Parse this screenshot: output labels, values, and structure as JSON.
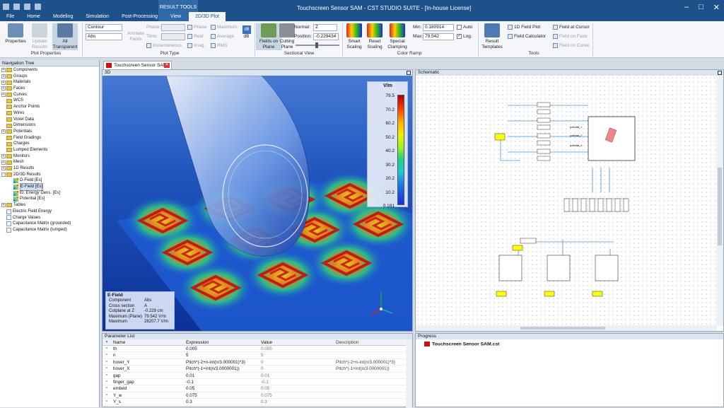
{
  "app": {
    "title": "Touchscreen Sensor SAM - CST STUDIO SUITE - [In-house License]",
    "context_header": "RESULT TOOLS"
  },
  "tabs": [
    "File",
    "Home",
    "Modeling",
    "Simulation",
    "Post-Processing",
    "View",
    "2D/3D Plot"
  ],
  "ribbon": {
    "properties": "Properties",
    "update_results": "Update Results",
    "all_transparent": "All Transparent",
    "group_plot_props": "Plot Properties",
    "contour": "Contour",
    "abs": "Abs",
    "animate_fields": "Animate Fields",
    "phase": "Phase:",
    "time": "Time:",
    "instantaneous": "Instantaneous",
    "phase2": "Phase",
    "real": "Real",
    "imag": "Imag.",
    "maximum": "Maximum",
    "average": "Average",
    "rms": "RMS",
    "db": "dB",
    "group_plot_type": "Plot Type",
    "fields_on_plane": "Fields on Plane",
    "cutting_plane": "Cutting Plane",
    "normal_label": "Normal:",
    "normal_value": "Z",
    "position_label": "Position:",
    "position_value": "-0.229434",
    "group_sectional": "Sectional View",
    "smart_scaling": "Smart Scaling",
    "reset_scaling": "Reset Scaling",
    "special_clamping": "Special Clamping",
    "min_label": "Min:",
    "min_value": "0.180914",
    "max_label": "Max:",
    "max_value": "79.542",
    "auto": "Auto",
    "log": "Log.",
    "group_color_ramp": "Color Ramp",
    "result_templates": "Result Templates",
    "field_plot_1d": "1D Field Plot",
    "field_calculator": "Field Calculator",
    "field_at_cursor": "Field at Cursor",
    "field_on_face": "Field on Face",
    "field_on_curve": "Field on Curve",
    "group_tools": "Tools"
  },
  "nav": {
    "header": "Navigation Tree",
    "items": [
      {
        "label": "Components",
        "level": 0,
        "exp": "+",
        "icon": "fold"
      },
      {
        "label": "Groups",
        "level": 0,
        "exp": "+",
        "icon": "fold"
      },
      {
        "label": "Materials",
        "level": 0,
        "exp": "+",
        "icon": "fold"
      },
      {
        "label": "Faces",
        "level": 0,
        "exp": "+",
        "icon": "fold"
      },
      {
        "label": "Curves",
        "level": 0,
        "exp": "+",
        "icon": "fold"
      },
      {
        "label": "WCS",
        "level": 0,
        "exp": "",
        "icon": "fold"
      },
      {
        "label": "Anchor Points",
        "level": 0,
        "exp": "",
        "icon": "fold"
      },
      {
        "label": "Wires",
        "level": 0,
        "exp": "",
        "icon": "fold"
      },
      {
        "label": "Voxel Data",
        "level": 0,
        "exp": "",
        "icon": "fold"
      },
      {
        "label": "Dimensions",
        "level": 0,
        "exp": "",
        "icon": "fold"
      },
      {
        "label": "Potentials",
        "level": 0,
        "exp": "+",
        "icon": "fold"
      },
      {
        "label": "Field Gradings",
        "level": 0,
        "exp": "",
        "icon": "fold"
      },
      {
        "label": "Charges",
        "level": 0,
        "exp": "",
        "icon": "fold"
      },
      {
        "label": "Lumped Elements",
        "level": 0,
        "exp": "",
        "icon": "fold"
      },
      {
        "label": "Monitors",
        "level": 0,
        "exp": "+",
        "icon": "fold"
      },
      {
        "label": "Mesh",
        "level": 0,
        "exp": "+",
        "icon": "fold"
      },
      {
        "label": "1D Results",
        "level": 0,
        "exp": "+",
        "icon": "fold"
      },
      {
        "label": "2D/3D Results",
        "level": 0,
        "exp": "-",
        "icon": "fold"
      },
      {
        "label": "D-Field [Es]",
        "level": 1,
        "exp": "",
        "icon": "leafc"
      },
      {
        "label": "E-Field [Es]",
        "level": 1,
        "exp": "",
        "icon": "leafc",
        "sel": true
      },
      {
        "label": "El. Energy Dens. [Es]",
        "level": 1,
        "exp": "",
        "icon": "leafc"
      },
      {
        "label": "Potential [Es]",
        "level": 1,
        "exp": "",
        "icon": "leafc"
      },
      {
        "label": "Tables",
        "level": 0,
        "exp": "+",
        "icon": "fold"
      },
      {
        "label": "Electric Field Energy",
        "level": 0,
        "exp": "",
        "icon": "leaf"
      },
      {
        "label": "Charge Values",
        "level": 0,
        "exp": "",
        "icon": "leaf"
      },
      {
        "label": "Capacitance Matrix (grounded)",
        "level": 0,
        "exp": "",
        "icon": "leaf"
      },
      {
        "label": "Capacitance Matrix (lumped)",
        "level": 0,
        "exp": "",
        "icon": "leaf"
      }
    ]
  },
  "doc_tab": "Touchscreen Sensor SAM",
  "panel3d": {
    "title": "3D"
  },
  "legend": {
    "unit": "V/m",
    "ticks": [
      "79.5",
      "70.2",
      "60.2",
      "50.2",
      "40.2",
      "30.2",
      "20.2",
      "10.2",
      "0.181"
    ]
  },
  "info": {
    "title": "E-Field",
    "rows": [
      [
        "Component",
        "Abs"
      ],
      [
        "Cross section",
        "A"
      ],
      [
        "Cutplane at Z",
        "-0.229 cm"
      ],
      [
        "Maximum (Plane)",
        "79.542 V/m"
      ],
      [
        "Maximum",
        "28207.7 V/m"
      ]
    ]
  },
  "schematic": {
    "title": "Schematic",
    "labels": [
      "potential_1",
      "potential_2",
      "potential_3"
    ]
  },
  "params": {
    "title": "Parameter List",
    "columns": [
      "Name",
      "Expression",
      "Value",
      "Description"
    ],
    "rows": [
      [
        "th",
        "0.005",
        "0.005",
        ""
      ],
      [
        "n",
        "5",
        "5",
        ""
      ],
      [
        "hover_Y",
        "Pitch*(-2+n-int(n/3.000001)*3)",
        "0",
        "Pitch*(-2+n-int(n/3.000001)*3)"
      ],
      [
        "hover_X",
        "Pitch*(-1+int(n/3.0000001))",
        "0",
        "Pitch*(-1+int(n/3.0000001))"
      ],
      [
        "gap",
        "0.01",
        "0.01",
        ""
      ],
      [
        "finger_gap",
        "-0.1",
        "-0.1",
        ""
      ],
      [
        "embed",
        "0.05",
        "0.05",
        ""
      ],
      [
        "Y_w",
        "0.075",
        "0.075",
        ""
      ],
      [
        "Y_s",
        "0.3",
        "0.3",
        ""
      ]
    ]
  },
  "progress": {
    "title": "Progress",
    "item": "Touchscreen Sensor SAM.cst"
  }
}
